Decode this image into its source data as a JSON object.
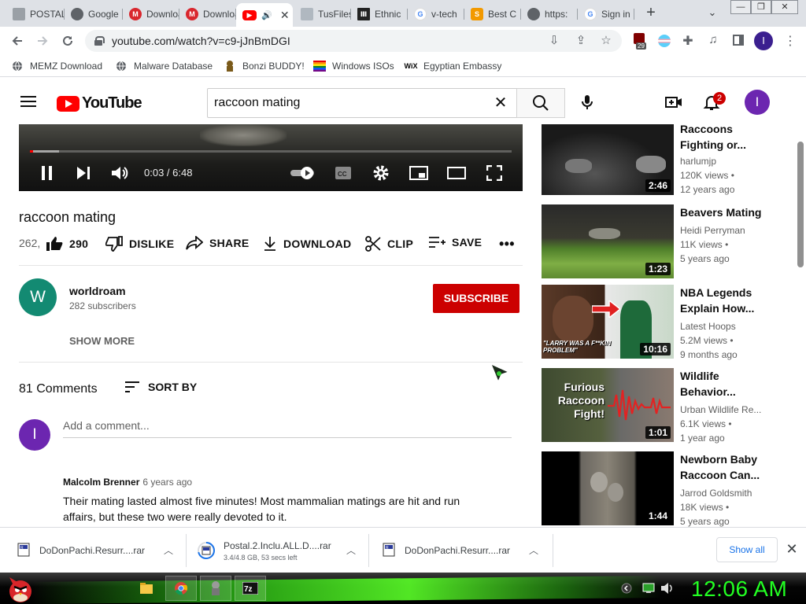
{
  "browser": {
    "tabs": [
      {
        "title": "POSTAL",
        "favicon": "postal-favicon",
        "active": false
      },
      {
        "title": "Google",
        "favicon": "globe-icon",
        "active": false
      },
      {
        "title": "Download",
        "favicon": "mega-icon",
        "active": false
      },
      {
        "title": "Download",
        "favicon": "mega-icon",
        "active": false
      },
      {
        "title": "",
        "favicon": "youtube-icon",
        "active": true,
        "audio": true
      },
      {
        "title": "TusFiles",
        "favicon": "tusfiles-icon",
        "active": false
      },
      {
        "title": "Ethnic",
        "favicon": "museum-icon",
        "active": false
      },
      {
        "title": "v-tech",
        "favicon": "google-icon",
        "active": false
      },
      {
        "title": "Best C",
        "favicon": "s-icon",
        "active": false
      },
      {
        "title": "https:",
        "favicon": "globe-icon",
        "active": false
      },
      {
        "title": "Sign in",
        "favicon": "google-icon",
        "active": false
      }
    ],
    "new_tab": "+",
    "url": "youtube.com/watch?v=c9-jJnBmDGI",
    "extension_badge": "29",
    "profile_initial": "I"
  },
  "bookmarks": [
    {
      "label": "MEMZ Download",
      "icon": "globe-icon"
    },
    {
      "label": "Malware Database",
      "icon": "globe-icon"
    },
    {
      "label": "Bonzi BUDDY!",
      "icon": "bonzi-icon"
    },
    {
      "label": "Windows ISOs",
      "icon": "windows-flag-icon"
    },
    {
      "label": "Egyptian Embassy",
      "icon": "wix-icon"
    }
  ],
  "youtube": {
    "logo_text": "YouTube",
    "search_query": "raccoon mating",
    "notifications": "2",
    "avatar_initial": "I"
  },
  "player": {
    "current_time": "0:03",
    "duration": "6:48",
    "time_display": "0:03 / 6:48",
    "played_fraction": 0.007,
    "loaded_fraction": 0.06
  },
  "video": {
    "title": "raccoon mating",
    "views_truncated": "262,",
    "likes": "290",
    "actions": {
      "dislike": "DISLIKE",
      "share": "SHARE",
      "download": "DOWNLOAD",
      "clip": "CLIP",
      "save": "SAVE"
    }
  },
  "channel": {
    "initial": "W",
    "name": "worldroam",
    "subscribers": "282 subscribers",
    "subscribe_label": "SUBSCRIBE",
    "show_more": "SHOW MORE"
  },
  "comments": {
    "count_label": "81 Comments",
    "sort_label": "SORT BY",
    "user_initial": "I",
    "add_placeholder": "Add a comment...",
    "items": [
      {
        "author": "Malcolm Brenner",
        "age": "6 years ago",
        "text": "Their mating lasted almost five minutes!  Most mammalian matings are hit and run affairs, but these two were really devoted to it."
      }
    ]
  },
  "recommendations": [
    {
      "title": "Raccoons Fighting or...",
      "channel": "harlumjp",
      "views": "120K views •",
      "age": "12 years ago",
      "duration": "2:46"
    },
    {
      "title": "Beavers Mating",
      "channel": "Heidi Perryman",
      "views": "11K views •",
      "age": "5 years ago",
      "duration": "1:23"
    },
    {
      "title": "NBA Legends Explain How...",
      "channel": "Latest Hoops",
      "views": "5.2M views •",
      "age": "9 months ago",
      "duration": "10:16",
      "thumb_caption": "\"LARRY WAS A F**KIN PROBLEM\""
    },
    {
      "title": "Wildlife Behavior...",
      "channel": "Urban Wildlife Re...",
      "views": "6.1K views •",
      "age": "1 year ago",
      "duration": "1:01",
      "thumb_caption": "Furious Raccoon Fight!"
    },
    {
      "title": "Newborn Baby Raccoon Can...",
      "channel": "Jarrod Goldsmith",
      "views": "18K views •",
      "age": "5 years ago",
      "duration": "1:44"
    }
  ],
  "downloads": [
    {
      "name": "DoDonPachi.Resurr....rar",
      "status": ""
    },
    {
      "name": "Postal.2.Inclu.ALL.D....rar",
      "status": "3.4/4.8 GB, 53 secs left"
    },
    {
      "name": "DoDonPachi.Resurr....rar",
      "status": ""
    }
  ],
  "download_bar": {
    "show_all": "Show all"
  },
  "taskbar": {
    "clock": "12:06 AM",
    "apps": [
      "file-explorer-icon",
      "chrome-icon",
      "bonzi-app-icon",
      "7zip-icon"
    ]
  }
}
